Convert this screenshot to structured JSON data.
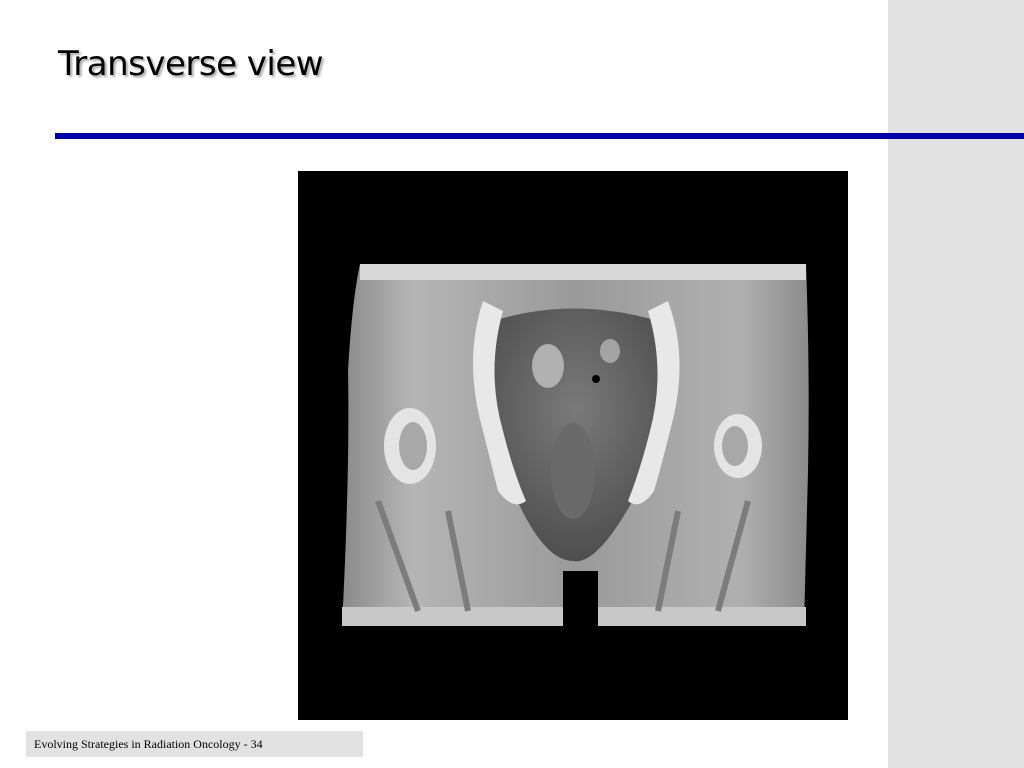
{
  "slide": {
    "title": "Transverse view",
    "footer": "Evolving Strategies in Radiation Oncology - 34"
  },
  "image": {
    "subject": "CT scan image of pelvis (transverse view)"
  },
  "colors": {
    "rule": "#0000a8",
    "panel": "#e2e2e2",
    "image_background": "#000000"
  }
}
